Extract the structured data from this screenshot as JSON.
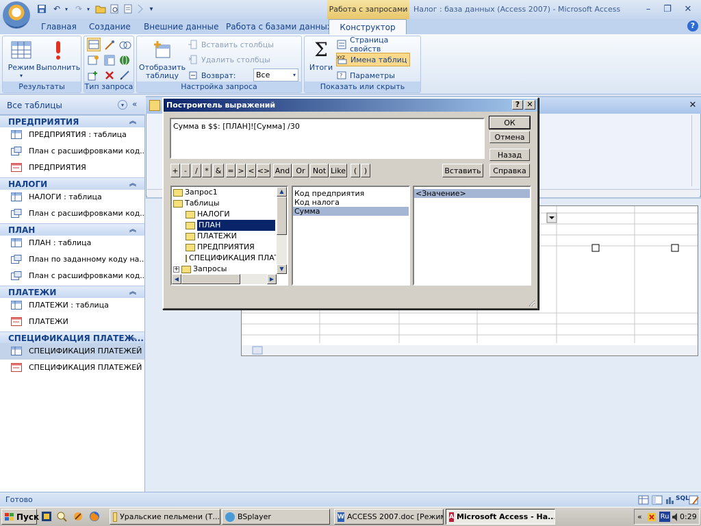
{
  "title_bar": {
    "context_tab_header": "Работа с запросами",
    "window_title": "Налог : база данных (Access 2007) - Microsoft Access"
  },
  "ribbon_tabs": [
    "Главная",
    "Создание",
    "Внешние данные",
    "Работа с базами данных"
  ],
  "active_tab": "Конструктор",
  "groups": {
    "results": {
      "label": "Результаты",
      "mode": "Режим",
      "run": "Выполнить"
    },
    "query_type": {
      "label": "Тип запроса"
    },
    "query_setup": {
      "label": "Настройка запроса",
      "show_table_line1": "Отобразить",
      "show_table_line2": "таблицу",
      "insert_columns": "Вставить столбцы",
      "delete_columns": "Удалить столбцы",
      "return_label": "Возврат:",
      "return_value": "Все"
    },
    "show_hide": {
      "label": "Показать или скрыть",
      "totals": "Итоги",
      "property_sheet": "Страница свойств",
      "table_names": "Имена таблиц",
      "parameters": "Параметры"
    }
  },
  "nav": {
    "header": "Все таблицы",
    "groups": [
      {
        "title": "ПРЕДПРИЯТИЯ",
        "items": [
          "ПРЕДПРИЯТИЯ : таблица",
          "План с расшифровками код...",
          "ПРЕДПРИЯТИЯ"
        ]
      },
      {
        "title": "НАЛОГИ",
        "items": [
          "НАЛОГИ : таблица",
          "План с расшифровками код..."
        ]
      },
      {
        "title": "ПЛАН",
        "items": [
          "ПЛАН : таблица",
          "План по заданному коду на...",
          "План с расшифровками код..."
        ]
      },
      {
        "title": "ПЛАТЕЖИ",
        "items": [
          "ПЛАТЕЖИ : таблица",
          "ПЛАТЕЖИ"
        ]
      },
      {
        "title": "СПЕЦИФИКАЦИЯ ПЛАТЕЖ...",
        "items": [
          "СПЕЦИФИКАЦИЯ ПЛАТЕЖЕЙ ...",
          "СПЕЦИФИКАЦИЯ ПЛАТЕЖЕЙ ..."
        ]
      }
    ]
  },
  "dialog": {
    "title": "Построитель выражений",
    "help_ctl": "?",
    "close_ctl": "✕",
    "expression": "Сумма в $$: [ПЛАН]![Сумма] /30",
    "buttons": {
      "ok": "ОК",
      "cancel": "Отмена",
      "back": "Назад",
      "paste": "Вставить",
      "help": "Справка"
    },
    "operators": [
      "+",
      "-",
      "/",
      "*",
      "&",
      "=",
      ">",
      "<",
      "<>",
      "And",
      "Or",
      "Not",
      "Like",
      "(",
      ")"
    ],
    "tree": {
      "query": "Запрос1",
      "tables": "Таблицы",
      "children": [
        "НАЛОГИ",
        "ПЛАН",
        "ПЛАТЕЖИ",
        "ПРЕДПРИЯТИЯ",
        "СПЕЦИФИКАЦИЯ ПЛАТ"
      ],
      "queries": "Запросы"
    },
    "fields": [
      "Код предприятия",
      "Код налога",
      "Сумма"
    ],
    "values": [
      "<Значение>"
    ]
  },
  "status": {
    "text": "Готово"
  },
  "taskbar": {
    "start": "Пуск",
    "tasks": [
      "Уральские пельмени (Т...",
      "BSplayer",
      "ACCESS 2007.doc [Режим...",
      "Microsoft Access - На..."
    ],
    "lang": "Ru",
    "clock": "0:29"
  },
  "colors": {
    "dialog_title_start": "#0a246a",
    "ribbon_accent": "#15428b",
    "context_tab": "#e8c76a"
  }
}
